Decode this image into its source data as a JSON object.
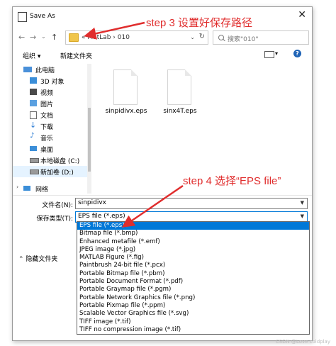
{
  "window": {
    "title": "Save As",
    "close_glyph": "✕"
  },
  "nav": {
    "back": "←",
    "forward": "→",
    "dropdown": "⌄",
    "up": "↑"
  },
  "address": {
    "prefix": "«",
    "path": "MatLab  ›  010",
    "dropdown": "⌄",
    "refresh": "↻"
  },
  "search": {
    "placeholder": "搜索\"010\""
  },
  "toolbar": {
    "organize": "组织 ▾",
    "new_folder": "新建文件夹",
    "view": "▾",
    "help": "?"
  },
  "sidebar": {
    "items": [
      {
        "label": "此电脑",
        "icon": "computer-icon",
        "color": "#4a90d9"
      },
      {
        "label": "3D 对象",
        "icon": "cube-icon",
        "color": "#3b8ed8"
      },
      {
        "label": "视频",
        "icon": "video-icon",
        "color": "#4a4a4a"
      },
      {
        "label": "图片",
        "icon": "picture-icon",
        "color": "#5aa0e0"
      },
      {
        "label": "文档",
        "icon": "document-icon",
        "color": "#6c6c6c"
      },
      {
        "label": "下载",
        "icon": "download-icon",
        "color": "#2a7bd4"
      },
      {
        "label": "音乐",
        "icon": "music-icon",
        "color": "#2a7bd4"
      },
      {
        "label": "桌面",
        "icon": "desktop-icon",
        "color": "#3b8ed8"
      },
      {
        "label": "本地磁盘 (C:)",
        "icon": "drive-icon",
        "color": "#777777"
      },
      {
        "label": "新加卷 (D:)",
        "icon": "drive-icon",
        "color": "#777777"
      },
      {
        "label": "网络",
        "icon": "network-icon",
        "color": "#3b8ed8"
      }
    ]
  },
  "files": [
    {
      "name": "sinpidivx.eps"
    },
    {
      "name": "sinx4T.eps"
    }
  ],
  "form": {
    "filename_label": "文件名(N):",
    "filename_value": "sinpidivx",
    "type_label": "保存类型(T):",
    "type_value": "EPS file (*.eps)"
  },
  "hide_folders": "⌃  隐藏文件夹",
  "file_types": [
    "EPS file (*.eps)",
    "Bitmap file (*.bmp)",
    "Enhanced metafile (*.emf)",
    "JPEG image (*.jpg)",
    "MATLAB Figure (*.fig)",
    "Paintbrush 24-bit file (*.pcx)",
    "Portable Bitmap file (*.pbm)",
    "Portable Document Format (*.pdf)",
    "Portable Graymap file (*.pgm)",
    "Portable Network Graphics file (*.png)",
    "Portable Pixmap file (*.ppm)",
    "Scalable Vector Graphics file (*.svg)",
    "TIFF image (*.tif)",
    "TIFF no compression image (*.tif)"
  ],
  "annotations": {
    "step3": "step 3 设置好保存路径",
    "step4": "step 4 选择“EPS file”",
    "color": "#e02d2d"
  },
  "watermark": "CSDN @Love coldplay"
}
